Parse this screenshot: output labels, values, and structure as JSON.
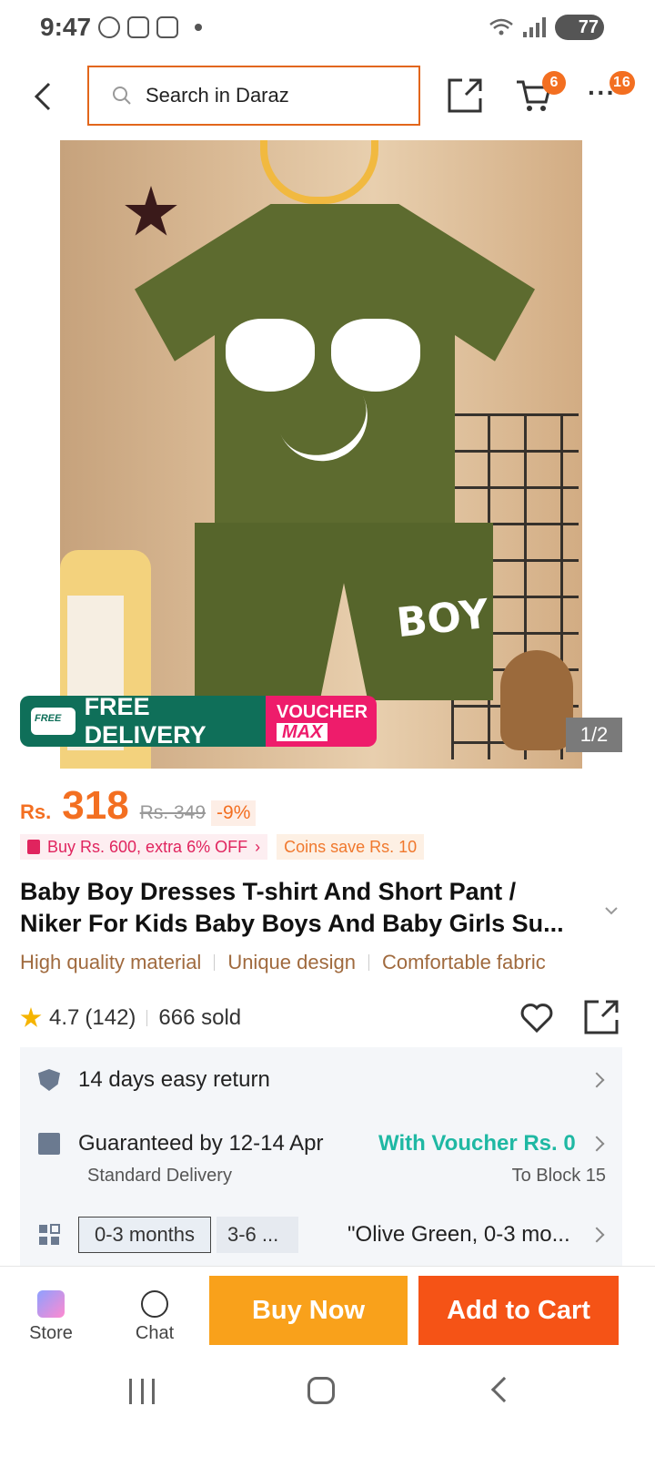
{
  "status_bar": {
    "time": "9:47",
    "battery": "77"
  },
  "header": {
    "search_placeholder": "Search in Daraz",
    "cart_badge": "6",
    "more_badge": "16"
  },
  "gallery": {
    "shirt_text": "BOY",
    "promo_free_delivery": "FREE DELIVERY",
    "promo_free_tag": "FREE",
    "promo_voucher": "VOUCHER",
    "promo_voucher_max": "MAX",
    "pager": "1/2"
  },
  "price": {
    "currency": "Rs.",
    "amount": "318",
    "original": "Rs. 349",
    "discount": "-9%"
  },
  "promotions": {
    "bundle": "Buy Rs. 600, extra 6% OFF",
    "coins": "Coins save Rs. 10"
  },
  "product": {
    "title_line1": "Baby Boy Dresses T-shirt And Short Pant /",
    "title_line2": "Niker For Kids Baby Boys And Baby Girls Su...",
    "features": [
      "High quality material",
      "Unique design",
      "Comfortable fabric"
    ],
    "rating": "4.7",
    "reviews": "(142)",
    "sold": "666 sold"
  },
  "info": {
    "return": "14 days easy return",
    "delivery": "Guaranteed by 12-14 Apr",
    "delivery_type": "Standard Delivery",
    "voucher": "With Voucher Rs. 0",
    "location": "To Block 15",
    "variant_1": "0-3 months",
    "variant_2": "3-6 ...",
    "variant_selected": "\"Olive Green, 0-3 mo..."
  },
  "actions": {
    "store": "Store",
    "chat": "Chat",
    "buy_now": "Buy Now",
    "add_to_cart": "Add to Cart"
  },
  "colors": {
    "brand_orange": "#f36f21",
    "buy_now": "#f9a11b",
    "add_to_cart": "#f55316",
    "free_delivery": "#0f6f59",
    "voucher_max": "#ee1c6b",
    "voucher_text": "#1fb8a3"
  }
}
